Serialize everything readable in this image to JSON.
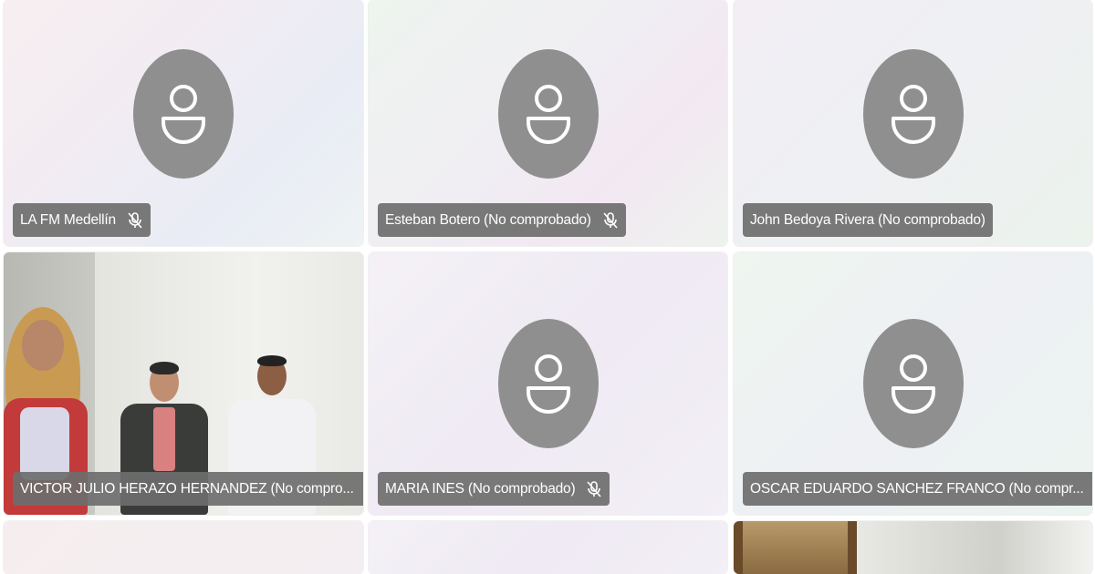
{
  "participants": [
    {
      "name": "LA FM Medellín",
      "muted": true
    },
    {
      "name": "Esteban Botero (No comprobado)",
      "muted": true
    },
    {
      "name": "John Bedoya Rivera (No comprobado)",
      "muted": false
    },
    {
      "name": "VICTOR JULIO HERAZO HERNANDEZ (No compro...",
      "muted": true,
      "video": true
    },
    {
      "name": "MARIA INES (No comprobado)",
      "muted": true
    },
    {
      "name": "OSCAR EDUARDO SANCHEZ FRANCO (No compr...",
      "muted": true
    }
  ],
  "icons": {
    "avatar": "person-placeholder-icon",
    "mic": "mic-off-icon"
  },
  "colors": {
    "avatar_bg": "#8f8f8f",
    "label_bg": "#6e6e6e",
    "label_text": "#ffffff"
  }
}
